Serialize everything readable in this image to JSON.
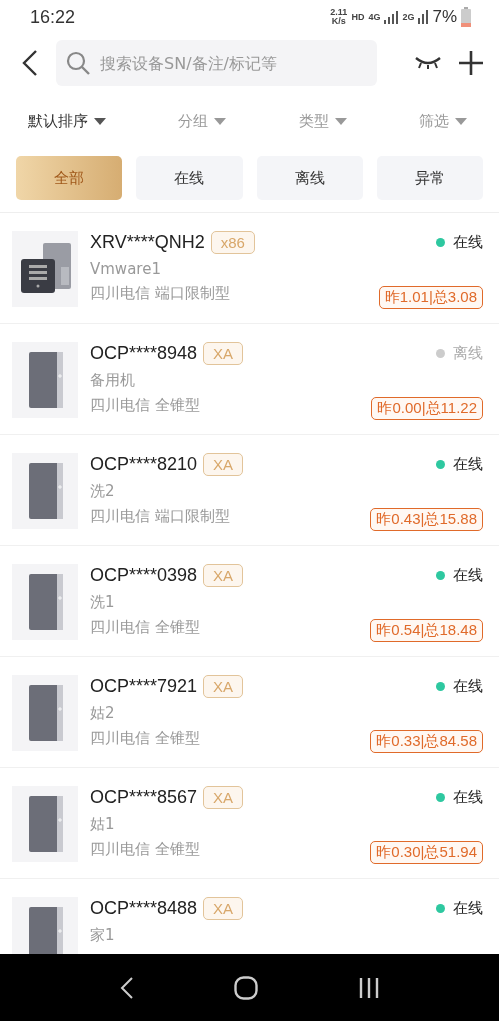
{
  "status_bar": {
    "time": "16:22",
    "speed_value": "2.11",
    "speed_unit": "K/s",
    "hd": "HD",
    "net_4g": "4G",
    "net_2g": "2G",
    "battery": "7%"
  },
  "search": {
    "placeholder": "搜索设备SN/备注/标记等"
  },
  "sort_options": [
    {
      "label": "默认排序",
      "selected": true
    },
    {
      "label": "分组",
      "selected": false
    },
    {
      "label": "类型",
      "selected": false
    },
    {
      "label": "筛选",
      "selected": false
    }
  ],
  "tabs": [
    {
      "label": "全部",
      "selected": true
    },
    {
      "label": "在线",
      "selected": false
    },
    {
      "label": "离线",
      "selected": false
    },
    {
      "label": "异常",
      "selected": false
    }
  ],
  "devices": [
    {
      "kind": "x86",
      "sn": "XRV****QNH2",
      "tag": "x86",
      "name": "Vmware1",
      "info": "四川电信 端口限制型",
      "status": "在线",
      "online": true,
      "usage": "昨1.01|总3.08"
    },
    {
      "kind": "xa",
      "sn": "OCP****8948",
      "tag": "XA",
      "name": "备用机",
      "info": "四川电信 全锥型",
      "status": "离线",
      "online": false,
      "usage": "昨0.00|总11.22"
    },
    {
      "kind": "xa",
      "sn": "OCP****8210",
      "tag": "XA",
      "name": "洗2",
      "info": "四川电信 端口限制型",
      "status": "在线",
      "online": true,
      "usage": "昨0.43|总15.88"
    },
    {
      "kind": "xa",
      "sn": "OCP****0398",
      "tag": "XA",
      "name": "洗1",
      "info": "四川电信 全锥型",
      "status": "在线",
      "online": true,
      "usage": "昨0.54|总18.48"
    },
    {
      "kind": "xa",
      "sn": "OCP****7921",
      "tag": "XA",
      "name": "姑2",
      "info": "四川电信 全锥型",
      "status": "在线",
      "online": true,
      "usage": "昨0.33|总84.58"
    },
    {
      "kind": "xa",
      "sn": "OCP****8567",
      "tag": "XA",
      "name": "姑1",
      "info": "四川电信 全锥型",
      "status": "在线",
      "online": true,
      "usage": "昨0.30|总51.94"
    },
    {
      "kind": "xa",
      "sn": "OCP****8488",
      "tag": "XA",
      "name": "家1",
      "status": "在线",
      "online": true
    }
  ]
}
